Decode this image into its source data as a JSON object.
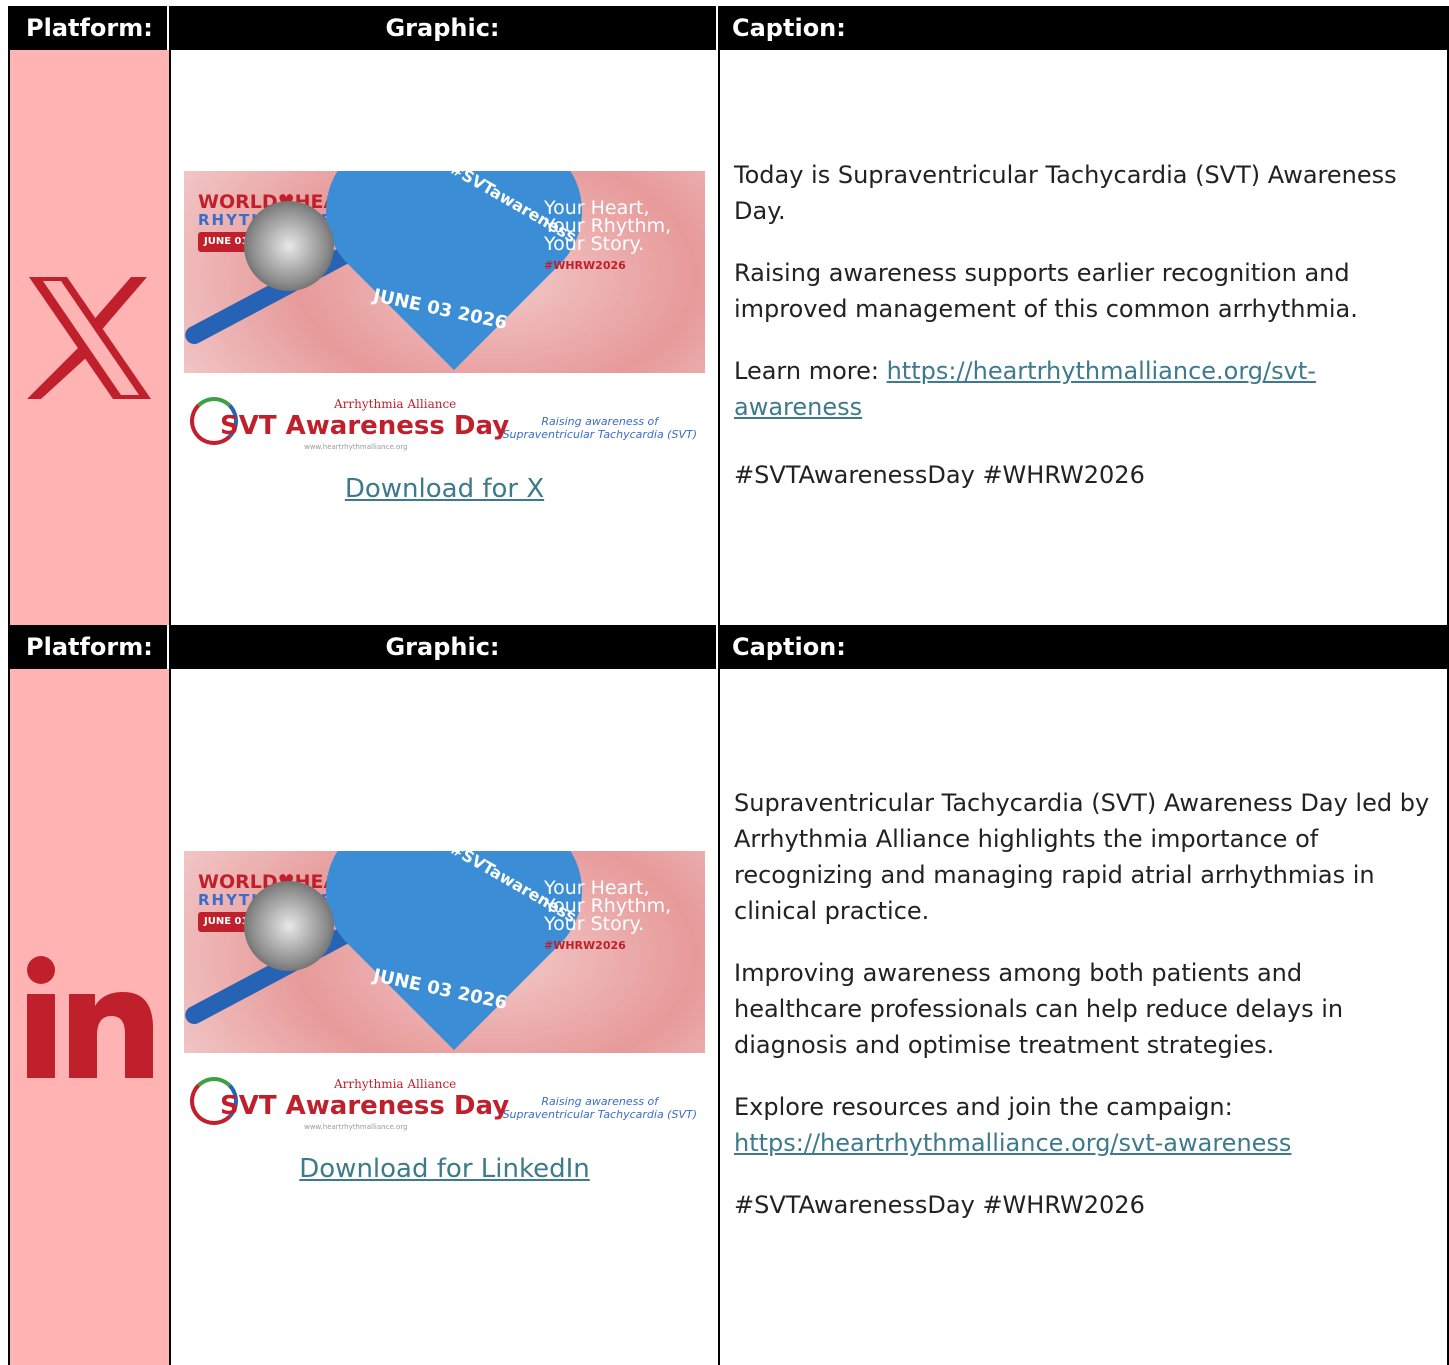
{
  "headers": {
    "platform": "Platform:",
    "graphic": "Graphic:",
    "caption": "Caption:"
  },
  "colors": {
    "accent": "#c0202b",
    "platform_bg": "#ffb3b3",
    "link": "#3d7a8c"
  },
  "poster": {
    "brand_top": "WORLD♥HEART",
    "brand_mid": "RHYTHM WEEK",
    "brand_dates": "JUNE 01-07 2026",
    "hashtag_heart": "#SVTawareness",
    "date": "JUNE 03 2026",
    "slogan_1": "Your Heart,",
    "slogan_2": "Your Rhythm,",
    "slogan_3": "Your Story.",
    "slogan_hash": "#WHRW2026",
    "org": "Arrhythmia Alliance",
    "title": "SVT Awareness Day",
    "url": "www.heartrhythmalliance.org",
    "raising_1": "Raising awareness of",
    "raising_2": "Supraventricular Tachycardia (SVT)"
  },
  "rows": [
    {
      "platform_icon": "x-logo-icon",
      "download_label": "Download for X",
      "caption": {
        "p1": "Today is Supraventricular Tachycardia (SVT) Awareness Day.",
        "p2": "Raising awareness supports earlier recognition and improved management of this common arrhythmia.",
        "p3_prefix": "Learn more: ",
        "p3_link": "https://heartrhythmalliance.org/svt-awareness",
        "p4": "#SVTAwarenessDay #WHRW2026"
      }
    },
    {
      "platform_icon": "linkedin-logo-icon",
      "download_label": "Download for LinkedIn",
      "caption": {
        "p1": "Supraventricular Tachycardia (SVT) Awareness Day led by Arrhythmia Alliance highlights the importance of recognizing and managing rapid atrial arrhythmias in clinical practice.",
        "p2": "Improving awareness among both patients and healthcare professionals can help reduce delays in diagnosis and optimise treatment strategies.",
        "p3_prefix": "Explore resources and join the campaign:",
        "p3_link": "https://heartrhythmalliance.org/svt-awareness",
        "p4": "#SVTAwarenessDay #WHRW2026"
      }
    }
  ]
}
